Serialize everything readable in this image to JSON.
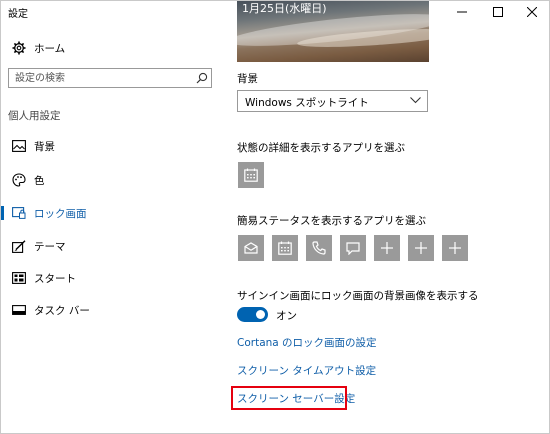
{
  "window": {
    "title": "設定"
  },
  "sidebar": {
    "home_label": "ホーム",
    "search_placeholder": "設定の検索",
    "section_label": "個人用設定",
    "items": [
      {
        "label": "背景",
        "icon": "picture-icon"
      },
      {
        "label": "色",
        "icon": "palette-icon"
      },
      {
        "label": "ロック画面",
        "icon": "lock-screen-icon",
        "selected": true
      },
      {
        "label": "テーマ",
        "icon": "theme-brush-icon"
      },
      {
        "label": "スタート",
        "icon": "start-icon"
      },
      {
        "label": "タスク バー",
        "icon": "taskbar-icon"
      }
    ]
  },
  "main": {
    "preview_date": "1月25日(水曜日)",
    "background_label": "背景",
    "background_value": "Windows スポットライト",
    "detailed_status_label": "状態の詳細を表示するアプリを選ぶ",
    "quick_status_label": "簡易ステータスを表示するアプリを選ぶ",
    "signin_label": "サインイン画面にロック画面の背景画像を表示する",
    "toggle_state": "オン",
    "links": {
      "cortana": "Cortana のロック画面の設定",
      "timeout": "スクリーン タイムアウト設定",
      "screensaver": "スクリーン セーバー設定"
    }
  },
  "colors": {
    "accent": "#0063b1",
    "link": "#0f5ea8",
    "tile": "#9a9a9a",
    "highlight": "#e5000f"
  }
}
